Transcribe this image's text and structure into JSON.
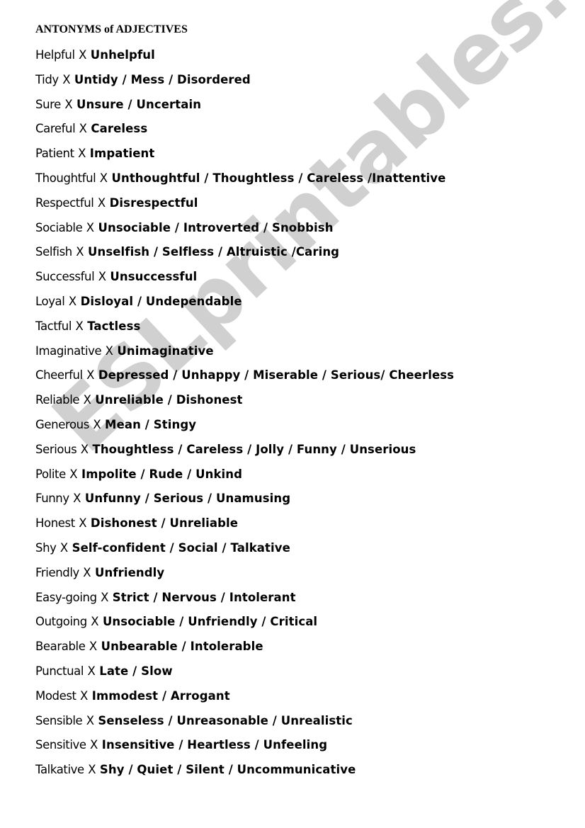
{
  "title": "ANTONYMS of ADJECTIVES",
  "separator": "X",
  "watermark": "ESLprintables.com",
  "pairs": [
    {
      "word": "Helpful",
      "antonyms": "Unhelpful"
    },
    {
      "word": "Tidy",
      "antonyms": "Untidy / Mess / Disordered"
    },
    {
      "word": "Sure",
      "antonyms": "Unsure / Uncertain"
    },
    {
      "word": "Careful",
      "antonyms": "Careless"
    },
    {
      "word": "Patient",
      "antonyms": "Impatient"
    },
    {
      "word": "Thoughtful",
      "antonyms": "Unthoughtful / Thoughtless / Careless /Inattentive"
    },
    {
      "word": "Respectful",
      "antonyms": "Disrespectful"
    },
    {
      "word": "Sociable",
      "antonyms": "Unsociable / Introverted / Snobbish"
    },
    {
      "word": "Selfish",
      "antonyms": "Unselfish / Selfless / Altruistic /Caring"
    },
    {
      "word": "Successful",
      "antonyms": "Unsuccessful"
    },
    {
      "word": "Loyal",
      "antonyms": "Disloyal / Undependable"
    },
    {
      "word": "Tactful",
      "antonyms": "Tactless"
    },
    {
      "word": "Imaginative",
      "antonyms": "Unimaginative"
    },
    {
      "word": "Cheerful",
      "antonyms": "Depressed / Unhappy / Miserable / Serious/ Cheerless"
    },
    {
      "word": "Reliable",
      "antonyms": "Unreliable / Dishonest"
    },
    {
      "word": "Generous",
      "antonyms": "Mean / Stingy"
    },
    {
      "word": "Serious",
      "antonyms": "Thoughtless / Careless / Jolly / Funny / Unserious"
    },
    {
      "word": "Polite",
      "antonyms": "Impolite / Rude / Unkind"
    },
    {
      "word": "Funny",
      "antonyms": "Unfunny / Serious / Unamusing"
    },
    {
      "word": "Honest",
      "antonyms": "Dishonest / Unreliable"
    },
    {
      "word": "Shy",
      "antonyms": "Self-confident / Social / Talkative"
    },
    {
      "word": "Friendly",
      "antonyms": "Unfriendly"
    },
    {
      "word": "Easy-going",
      "antonyms": "Strict / Nervous / Intolerant"
    },
    {
      "word": "Outgoing",
      "antonyms": "Unsociable / Unfriendly / Critical"
    },
    {
      "word": "Bearable",
      "antonyms": "Unbearable / Intolerable"
    },
    {
      "word": "Punctual",
      "antonyms": "Late / Slow"
    },
    {
      "word": "Modest",
      "antonyms": "Immodest / Arrogant"
    },
    {
      "word": "Sensible",
      "antonyms": "Senseless / Unreasonable / Unrealistic"
    },
    {
      "word": "Sensitive",
      "antonyms": "Insensitive / Heartless / Unfeeling"
    },
    {
      "word": "Talkative",
      "antonyms": "Shy / Quiet / Silent / Uncommunicative"
    }
  ]
}
